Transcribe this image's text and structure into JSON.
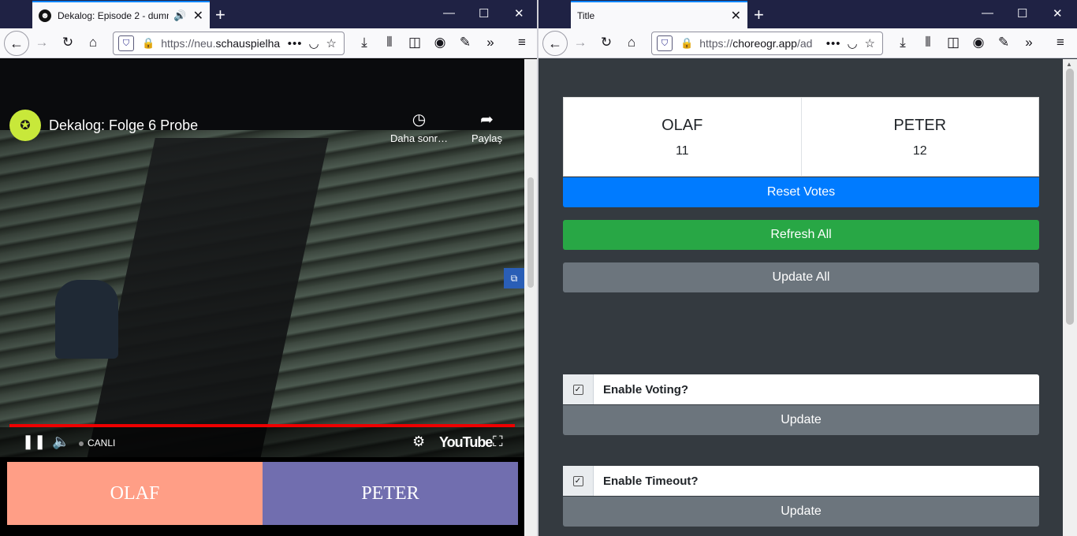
{
  "left_window": {
    "tab": {
      "title": "Dekalog: Episode 2 - dumm",
      "favicon": "smiley-icon",
      "audio_icon": "speaker-icon"
    },
    "url": {
      "prefix": "https://neu.",
      "host": "schauspielha"
    },
    "video": {
      "title": "Dekalog: Folge 6 Probe",
      "watch_later": "Daha sonr…",
      "share": "Paylaş",
      "live_label": "CANLI",
      "youtube_logo": "YouTube"
    },
    "vote_buttons": [
      {
        "label": "OLAF",
        "color": "#ff9e86"
      },
      {
        "label": "PETER",
        "color": "#716eaf"
      }
    ]
  },
  "right_window": {
    "tab": {
      "title": "Title"
    },
    "url": {
      "prefix": "https://",
      "host": "choreogr.app",
      "path": "/ad"
    },
    "scores": [
      {
        "name": "OLAF",
        "votes": "11"
      },
      {
        "name": "PETER",
        "votes": "12"
      }
    ],
    "buttons": {
      "reset": "Reset Votes",
      "refresh": "Refresh All",
      "update_all": "Update All"
    },
    "settings": [
      {
        "label": "Enable Voting?",
        "checked": true,
        "update": "Update"
      },
      {
        "label": "Enable Timeout?",
        "checked": true,
        "update": "Update"
      }
    ]
  },
  "colors": {
    "primary": "#007bff",
    "success": "#28a745",
    "secondary": "#6c757d",
    "dark": "#343a40",
    "tabstrip": "#1f2244"
  }
}
